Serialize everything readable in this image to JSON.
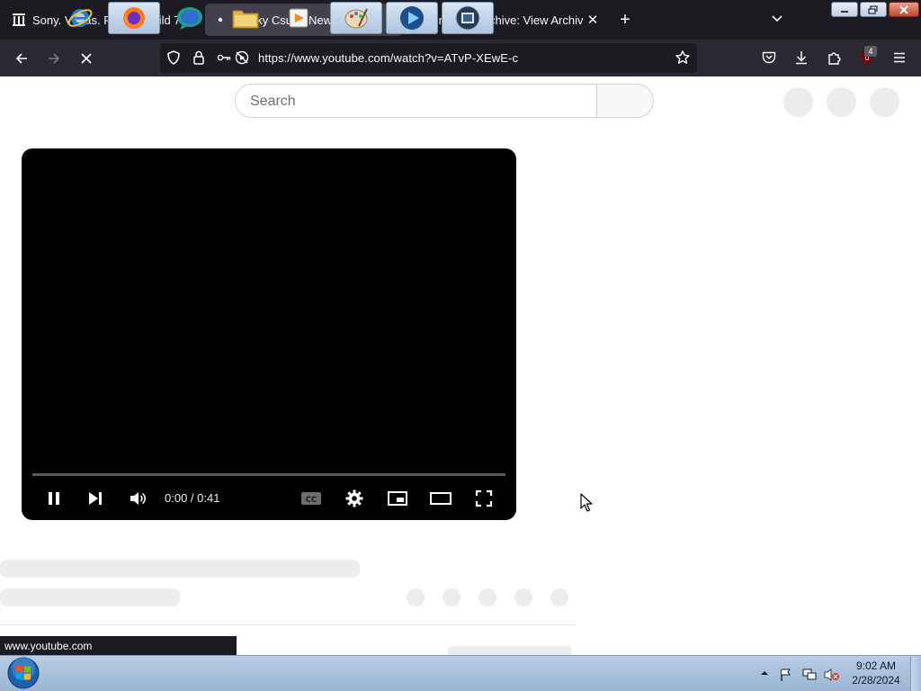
{
  "browser": {
    "tabs": [
      {
        "title": "Sony. Vegas. Pro 12. Build 770.64",
        "favicon": "archive-icon",
        "active": false
      },
      {
        "title": "Klasky Csupo Newer Version Sc",
        "favicon": "loading-dot-icon",
        "active": true
      },
      {
        "title": "Internet Archive: View Archive",
        "favicon": "archive-icon",
        "active": false
      }
    ],
    "url": "https://www.youtube.com/watch?v=ATvP-XEwE-c",
    "extension_badge": "4",
    "status_url": "www.youtube.com"
  },
  "youtube": {
    "search_placeholder": "Search",
    "player": {
      "time": "0:00 / 0:41",
      "progress": 0
    }
  },
  "taskbar": {
    "time": "9:02 AM",
    "date": "2/28/2024"
  },
  "colors": {
    "tabstrip": "#1c1b22",
    "navbar": "#2b2a33",
    "player": "#000000",
    "taskbar": "#a9c1dc"
  }
}
